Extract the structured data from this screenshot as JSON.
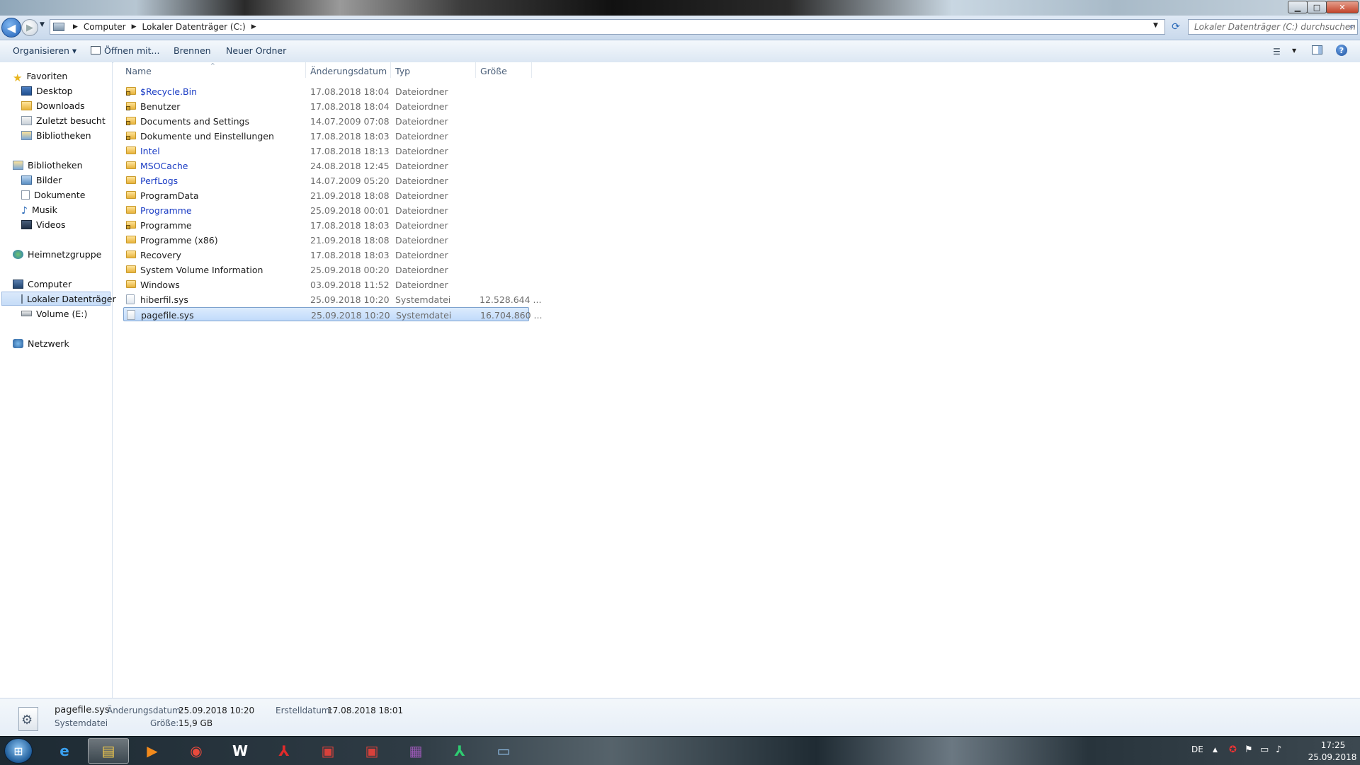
{
  "window": {
    "minimize_glyph": "▁",
    "maximize_glyph": "□",
    "close_glyph": "✕"
  },
  "nav": {
    "back_glyph": "◀",
    "forward_glyph": "▶",
    "history_glyph": "▼",
    "breadcrumbs": [
      "Computer",
      "Lokaler Datenträger (C:)"
    ],
    "crumb_sep": "▶",
    "dropdown_glyph": "▼",
    "refresh_glyph": "⟳",
    "search_placeholder": "Lokaler Datenträger (C:) durchsuchen",
    "search_glyph": "⌕"
  },
  "toolbar": {
    "organize": "Organisieren ▾",
    "open_with": "Öffnen mit...",
    "burn": "Brennen",
    "new_folder": "Neuer Ordner",
    "view_glyph": "☰",
    "view_dd_glyph": "▼",
    "help_glyph": "?"
  },
  "navpane": {
    "favorites": "Favoriten",
    "fav_items": [
      "Desktop",
      "Downloads",
      "Zuletzt besucht",
      "Bibliotheken"
    ],
    "libraries": "Bibliotheken",
    "lib_items": [
      "Bilder",
      "Dokumente",
      "Musik",
      "Videos"
    ],
    "homegroup": "Heimnetzgruppe",
    "computer": "Computer",
    "computer_items": [
      "Lokaler Datenträger",
      "Volume (E:)"
    ],
    "network": "Netzwerk"
  },
  "columns": {
    "name": "Name",
    "date": "Änderungsdatum",
    "type": "Typ",
    "size": "Größe",
    "sort_glyph": "^"
  },
  "files": [
    {
      "name": "$Recycle.Bin",
      "date": "17.08.2018 18:04",
      "type": "Dateiordner",
      "size": "",
      "hidden": true,
      "locked": true,
      "kind": "folder"
    },
    {
      "name": "Benutzer",
      "date": "17.08.2018 18:04",
      "type": "Dateiordner",
      "size": "",
      "hidden": false,
      "locked": true,
      "kind": "folder"
    },
    {
      "name": "Documents and Settings",
      "date": "14.07.2009 07:08",
      "type": "Dateiordner",
      "size": "",
      "hidden": false,
      "locked": true,
      "kind": "folder"
    },
    {
      "name": "Dokumente und Einstellungen",
      "date": "17.08.2018 18:03",
      "type": "Dateiordner",
      "size": "",
      "hidden": false,
      "locked": true,
      "kind": "folder"
    },
    {
      "name": "Intel",
      "date": "17.08.2018 18:13",
      "type": "Dateiordner",
      "size": "",
      "hidden": true,
      "locked": false,
      "kind": "folder"
    },
    {
      "name": "MSOCache",
      "date": "24.08.2018 12:45",
      "type": "Dateiordner",
      "size": "",
      "hidden": true,
      "locked": false,
      "kind": "folder"
    },
    {
      "name": "PerfLogs",
      "date": "14.07.2009 05:20",
      "type": "Dateiordner",
      "size": "",
      "hidden": true,
      "locked": false,
      "kind": "folder"
    },
    {
      "name": "ProgramData",
      "date": "21.09.2018 18:08",
      "type": "Dateiordner",
      "size": "",
      "hidden": false,
      "locked": false,
      "kind": "folder"
    },
    {
      "name": "Programme",
      "date": "25.09.2018 00:01",
      "type": "Dateiordner",
      "size": "",
      "hidden": true,
      "locked": false,
      "kind": "folder"
    },
    {
      "name": "Programme",
      "date": "17.08.2018 18:03",
      "type": "Dateiordner",
      "size": "",
      "hidden": false,
      "locked": true,
      "kind": "folder"
    },
    {
      "name": "Programme (x86)",
      "date": "21.09.2018 18:08",
      "type": "Dateiordner",
      "size": "",
      "hidden": false,
      "locked": false,
      "kind": "folder"
    },
    {
      "name": "Recovery",
      "date": "17.08.2018 18:03",
      "type": "Dateiordner",
      "size": "",
      "hidden": false,
      "locked": false,
      "kind": "folder"
    },
    {
      "name": "System Volume Information",
      "date": "25.09.2018 00:20",
      "type": "Dateiordner",
      "size": "",
      "hidden": false,
      "locked": false,
      "kind": "folder"
    },
    {
      "name": "Windows",
      "date": "03.09.2018 11:52",
      "type": "Dateiordner",
      "size": "",
      "hidden": false,
      "locked": false,
      "kind": "folder"
    },
    {
      "name": "hiberfil.sys",
      "date": "25.09.2018 10:20",
      "type": "Systemdatei",
      "size": "12.528.644 ...",
      "hidden": false,
      "locked": false,
      "kind": "file"
    },
    {
      "name": "pagefile.sys",
      "date": "25.09.2018 10:20",
      "type": "Systemdatei",
      "size": "16.704.860 ...",
      "hidden": false,
      "locked": false,
      "kind": "file",
      "selected": true
    }
  ],
  "details": {
    "filename": "pagefile.sys",
    "filetype": "Systemdatei",
    "modified_label": "Änderungsdatum:",
    "modified_value": "25.09.2018 10:20",
    "size_label": "Größe:",
    "size_value": "15,9 GB",
    "created_label": "Erstelldatum:",
    "created_value": "17.08.2018 18:01",
    "gear_glyph": "⚙"
  },
  "taskbar": {
    "start_glyph": "⊞",
    "apps": [
      {
        "name": "Internet Explorer",
        "glyph": "e",
        "color": "#3aa0f0",
        "active": false
      },
      {
        "name": "Windows Explorer",
        "glyph": "▤",
        "color": "#f2c94c",
        "active": true
      },
      {
        "name": "Media Player",
        "glyph": "▶",
        "color": "#f28a1c",
        "active": false
      },
      {
        "name": "Chrome",
        "glyph": "◉",
        "color": "#e84a3c",
        "active": false
      },
      {
        "name": "Word",
        "glyph": "W",
        "color": "#ffffff",
        "active": false
      },
      {
        "name": "Acrobat",
        "glyph": "⅄",
        "color": "#e12b2b",
        "active": false
      },
      {
        "name": "Toolbox 1",
        "glyph": "▣",
        "color": "#d8413b",
        "active": false
      },
      {
        "name": "Toolbox 2",
        "glyph": "▣",
        "color": "#d8413b",
        "active": false
      },
      {
        "name": "WinRAR",
        "glyph": "▦",
        "color": "#9b59b6",
        "active": false
      },
      {
        "name": "Tool Green",
        "glyph": "⅄",
        "color": "#2ecc71",
        "active": false
      },
      {
        "name": "Remote",
        "glyph": "▭",
        "color": "#8fbde6",
        "active": false
      }
    ],
    "language": "DE",
    "tray_up_glyph": "▲",
    "tray_icons": [
      "✪",
      "⚑",
      "▭",
      "♪"
    ],
    "time": "17:25",
    "date": "25.09.2018"
  }
}
